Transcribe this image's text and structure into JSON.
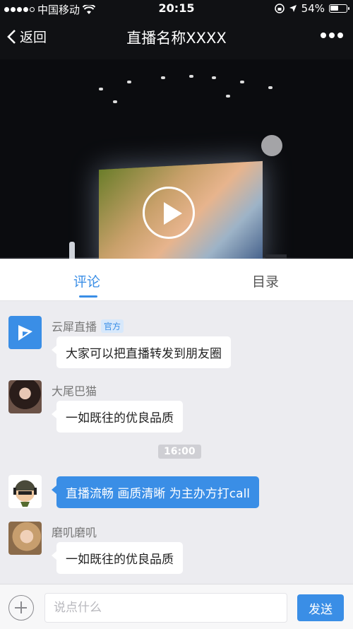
{
  "status_bar": {
    "carrier": "中国移动",
    "time": "20:15",
    "battery": "54%",
    "battery_level": 0.54,
    "signal_filled": 4,
    "signal_total": 5
  },
  "nav": {
    "back_label": "返回",
    "title": "直播名称XXXX"
  },
  "tabs": [
    {
      "label": "评论",
      "active": true
    },
    {
      "label": "目录",
      "active": false
    }
  ],
  "messages": [
    {
      "user": "云犀直播",
      "badge": "官方",
      "text": "大家可以把直播转发到朋友圈",
      "style": "white"
    },
    {
      "user": "大尾巴猫",
      "text": "一如既往的优良品质",
      "style": "white"
    },
    {
      "timestamp": "16:00"
    },
    {
      "user": "",
      "text": "直播流畅 画质清晰 为主办方打call",
      "style": "blue"
    },
    {
      "user": "磨叽磨叽",
      "text": "一如既往的优良品质",
      "style": "white"
    }
  ],
  "input": {
    "placeholder": "说点什么",
    "send_label": "发送"
  },
  "colors": {
    "accent": "#3a8ee6",
    "header_bg": "#101114",
    "chat_bg": "#ececf0"
  }
}
